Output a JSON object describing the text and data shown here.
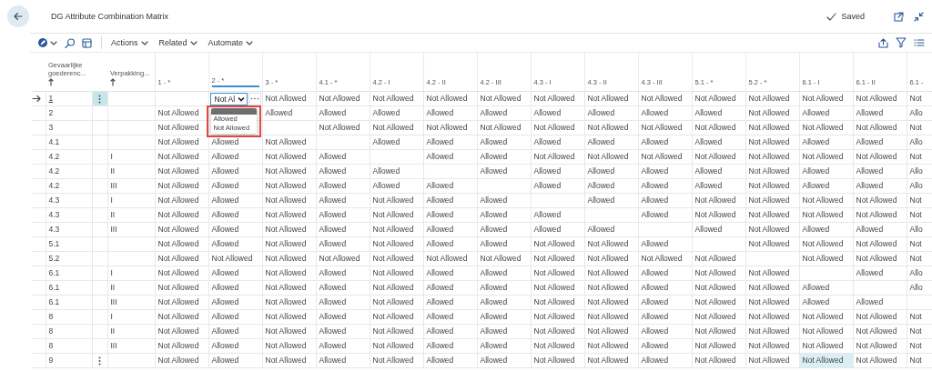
{
  "page": {
    "title": "DG Attribute Combination Matrix",
    "status": "Saved"
  },
  "toolbar": {
    "menus": [
      {
        "label": "Actions"
      },
      {
        "label": "Related"
      },
      {
        "label": "Automate"
      }
    ]
  },
  "table": {
    "key_columns": [
      {
        "label": "Gevaarlijke goederenc...",
        "sorted_ascending": true
      },
      {
        "label": "Verpakking...",
        "sorted_ascending": true
      }
    ],
    "columns": [
      {
        "label": "1 - *",
        "editing": false,
        "selected": false
      },
      {
        "label": "2 - *",
        "editing": true,
        "selected": false
      },
      {
        "label": "3 - *",
        "editing": false,
        "selected": false
      },
      {
        "label": "4.1 - *",
        "editing": false,
        "selected": false
      },
      {
        "label": "4.2 - I",
        "editing": false,
        "selected": false
      },
      {
        "label": "4.2 - II",
        "editing": false,
        "selected": false
      },
      {
        "label": "4.2 - III",
        "editing": false,
        "selected": false
      },
      {
        "label": "4.3 - I",
        "editing": false,
        "selected": false
      },
      {
        "label": "4.3 - II",
        "editing": false,
        "selected": false
      },
      {
        "label": "4.3 - III",
        "editing": false,
        "selected": false
      },
      {
        "label": "5.1 - *",
        "editing": false,
        "selected": false
      },
      {
        "label": "5.2 - *",
        "editing": false,
        "selected": false
      },
      {
        "label": "6.1 - I",
        "editing": false,
        "selected": true
      },
      {
        "label": "6.1 - II",
        "editing": false,
        "selected": false
      },
      {
        "label": "6.1 -",
        "editing": false,
        "selected": false
      }
    ],
    "rows": [
      {
        "code": "1",
        "current": true,
        "menu_button": true,
        "selected": false,
        "cells": [
          null,
          "Not Al",
          "Not Allowed",
          "Not Allowed",
          "Not Allowed",
          "Not Allowed",
          "Not Allowed",
          "Not Allowed",
          "Not Allowed",
          "Not Allowed",
          "Not Allowed",
          "Not Allowed",
          "Not Allowed",
          "Not Allowed",
          "Not"
        ]
      },
      {
        "code": "2",
        "current": false,
        "menu_button": false,
        "selected": false,
        "cells": [
          "Not Allowed",
          null,
          "Allowed",
          "Allowed",
          "Allowed",
          "Allowed",
          "Allowed",
          "Allowed",
          "Allowed",
          "Allowed",
          "Allowed",
          "Not Allowed",
          "Allowed",
          "Allowed",
          "Allo"
        ]
      },
      {
        "code": "3",
        "current": false,
        "menu_button": false,
        "selected": false,
        "cells": [
          "Not Allowed",
          null,
          null,
          "Not Allowed",
          "Not Allowed",
          "Not Allowed",
          "Not Allowed",
          "Not Allowed",
          "Not Allowed",
          "Not Allowed",
          "Not Allowed",
          "Not Allowed",
          "Not Allowed",
          "Not Allowed",
          "Not"
        ]
      },
      {
        "code": "4.1",
        "current": false,
        "menu_button": false,
        "selected": false,
        "cells": [
          "Not Allowed",
          "Allowed",
          "Not Allowed",
          null,
          "Allowed",
          "Allowed",
          "Allowed",
          "Allowed",
          "Allowed",
          "Allowed",
          "Allowed",
          "Not Allowed",
          "Allowed",
          "Allowed",
          "Allo"
        ]
      },
      {
        "code": "4.2",
        "packing": "I",
        "current": false,
        "menu_button": false,
        "selected": false,
        "cells": [
          "Not Allowed",
          "Allowed",
          "Not Allowed",
          "Allowed",
          null,
          "Allowed",
          "Allowed",
          "Not Allowed",
          "Not Allowed",
          "Not Allowed",
          "Not Allowed",
          "Not Allowed",
          "Not Allowed",
          "Not Allowed",
          "Not"
        ]
      },
      {
        "code": "4.2",
        "packing": "II",
        "current": false,
        "menu_button": false,
        "selected": false,
        "cells": [
          "Not Allowed",
          "Allowed",
          "Not Allowed",
          "Allowed",
          "Allowed",
          null,
          "Allowed",
          "Allowed",
          "Allowed",
          "Allowed",
          "Allowed",
          "Not Allowed",
          "Allowed",
          "Allowed",
          "Allo"
        ]
      },
      {
        "code": "4.2",
        "packing": "III",
        "current": false,
        "menu_button": false,
        "selected": false,
        "cells": [
          "Not Allowed",
          "Allowed",
          "Not Allowed",
          "Allowed",
          "Allowed",
          "Allowed",
          null,
          "Allowed",
          "Allowed",
          "Allowed",
          "Allowed",
          "Not Allowed",
          "Allowed",
          "Allowed",
          "Allo"
        ]
      },
      {
        "code": "4.3",
        "packing": "I",
        "current": false,
        "menu_button": false,
        "selected": false,
        "cells": [
          "Not Allowed",
          "Allowed",
          "Not Allowed",
          "Allowed",
          "Not Allowed",
          "Allowed",
          "Allowed",
          null,
          "Allowed",
          "Allowed",
          "Not Allowed",
          "Not Allowed",
          "Not Allowed",
          "Not Allowed",
          "Not"
        ]
      },
      {
        "code": "4.3",
        "packing": "II",
        "current": false,
        "menu_button": false,
        "selected": false,
        "cells": [
          "Not Allowed",
          "Allowed",
          "Not Allowed",
          "Allowed",
          "Not Allowed",
          "Allowed",
          "Allowed",
          "Allowed",
          null,
          "Allowed",
          "Not Allowed",
          "Not Allowed",
          "Not Allowed",
          "Not Allowed",
          "Not"
        ]
      },
      {
        "code": "4.3",
        "packing": "III",
        "current": false,
        "menu_button": false,
        "selected": false,
        "cells": [
          "Not Allowed",
          "Allowed",
          "Not Allowed",
          "Allowed",
          "Not Allowed",
          "Allowed",
          "Allowed",
          "Allowed",
          "Allowed",
          null,
          "Allowed",
          "Not Allowed",
          "Allowed",
          "Allowed",
          "Allo"
        ]
      },
      {
        "code": "5.1",
        "current": false,
        "menu_button": false,
        "selected": false,
        "cells": [
          "Not Allowed",
          "Allowed",
          "Not Allowed",
          "Allowed",
          "Not Allowed",
          "Allowed",
          "Allowed",
          "Not Allowed",
          "Not Allowed",
          "Allowed",
          null,
          "Not Allowed",
          "Not Allowed",
          "Not Allowed",
          "Not"
        ]
      },
      {
        "code": "5.2",
        "current": false,
        "menu_button": false,
        "selected": false,
        "cells": [
          "Not Allowed",
          "Not Allowed",
          "Not Allowed",
          "Not Allowed",
          "Not Allowed",
          "Not Allowed",
          "Not Allowed",
          "Not Allowed",
          "Not Allowed",
          "Not Allowed",
          "Not Allowed",
          null,
          "Not Allowed",
          "Not Allowed",
          "Not"
        ]
      },
      {
        "code": "6.1",
        "packing": "I",
        "current": false,
        "menu_button": false,
        "selected": false,
        "cells": [
          "Not Allowed",
          "Allowed",
          "Not Allowed",
          "Allowed",
          "Not Allowed",
          "Allowed",
          "Allowed",
          "Not Allowed",
          "Not Allowed",
          "Allowed",
          "Not Allowed",
          "Not Allowed",
          null,
          "Allowed",
          "Allo"
        ]
      },
      {
        "code": "6.1",
        "packing": "II",
        "current": false,
        "menu_button": false,
        "selected": false,
        "cells": [
          "Not Allowed",
          "Allowed",
          "Not Allowed",
          "Allowed",
          "Not Allowed",
          "Allowed",
          "Allowed",
          "Not Allowed",
          "Not Allowed",
          "Allowed",
          "Not Allowed",
          "Not Allowed",
          "Allowed",
          null,
          "Allo"
        ]
      },
      {
        "code": "6.1",
        "packing": "III",
        "current": false,
        "menu_button": false,
        "selected": false,
        "cells": [
          "Not Allowed",
          "Allowed",
          "Not Allowed",
          "Allowed",
          "Not Allowed",
          "Allowed",
          "Allowed",
          "Not Allowed",
          "Not Allowed",
          "Allowed",
          "Not Allowed",
          "Not Allowed",
          "Allowed",
          "Allowed",
          null
        ]
      },
      {
        "code": "8",
        "packing": "I",
        "current": false,
        "menu_button": false,
        "selected": false,
        "cells": [
          "Not Allowed",
          "Allowed",
          "Not Allowed",
          "Allowed",
          "Not Allowed",
          "Allowed",
          "Allowed",
          "Not Allowed",
          "Not Allowed",
          "Allowed",
          "Not Allowed",
          "Not Allowed",
          "Not Allowed",
          "Not Allowed",
          "Not"
        ]
      },
      {
        "code": "8",
        "packing": "II",
        "current": false,
        "menu_button": false,
        "selected": false,
        "cells": [
          "Not Allowed",
          "Allowed",
          "Not Allowed",
          "Allowed",
          "Not Allowed",
          "Allowed",
          "Allowed",
          "Not Allowed",
          "Not Allowed",
          "Allowed",
          "Not Allowed",
          "Not Allowed",
          "Not Allowed",
          "Not Allowed",
          "Not"
        ]
      },
      {
        "code": "8",
        "packing": "III",
        "current": false,
        "menu_button": false,
        "selected": false,
        "cells": [
          "Not Allowed",
          "Allowed",
          "Not Allowed",
          "Allowed",
          "Not Allowed",
          "Allowed",
          "Allowed",
          "Not Allowed",
          "Not Allowed",
          "Allowed",
          "Not Allowed",
          "Not Allowed",
          "Not Allowed",
          "Not Allowed",
          "Not"
        ]
      },
      {
        "code": "9",
        "current": false,
        "menu_button": true,
        "selected": true,
        "cells": [
          "Not Allowed",
          "Allowed",
          "Not Allowed",
          "Allowed",
          "Not Allowed",
          "Allowed",
          "Allowed",
          "Not Allowed",
          "Not Allowed",
          "Allowed",
          "Not Allowed",
          "Not Allowed",
          "Not Allowed",
          "Not Allowed",
          "Not"
        ]
      }
    ]
  },
  "dropdown": {
    "options": [
      {
        "label": "Allowed",
        "selected": false
      },
      {
        "label": "Not Allowed",
        "selected": false
      }
    ]
  }
}
